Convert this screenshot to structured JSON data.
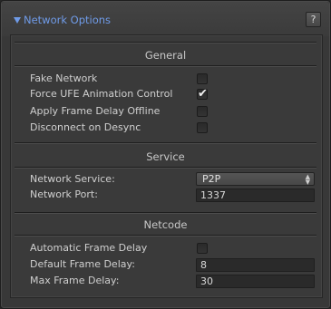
{
  "panel": {
    "title": "Network Options",
    "help_label": "?"
  },
  "sections": {
    "general": {
      "title": "General",
      "fake_network": {
        "label": "Fake Network",
        "checked": false
      },
      "force_ufe_animation_control": {
        "label": "Force UFE Animation Control",
        "checked": true,
        "mark": "✔"
      },
      "apply_frame_delay_offline": {
        "label": "Apply Frame Delay Offline",
        "checked": false
      },
      "disconnect_on_desync": {
        "label": "Disconnect on Desync",
        "checked": false
      }
    },
    "service": {
      "title": "Service",
      "network_service": {
        "label": "Network Service:",
        "value": "P2P"
      },
      "network_port": {
        "label": "Network Port:",
        "value": "1337"
      }
    },
    "netcode": {
      "title": "Netcode",
      "automatic_frame_delay": {
        "label": "Automatic Frame Delay",
        "checked": false
      },
      "default_frame_delay": {
        "label": "Default Frame Delay:",
        "value": "8"
      },
      "max_frame_delay": {
        "label": "Max Frame Delay:",
        "value": "30"
      }
    }
  },
  "icons": {
    "foldout": "foldout-expanded-icon",
    "dropdown": "dropdown-arrows-icon",
    "check": "checkmark-icon"
  },
  "colors": {
    "accent": "#6f9be8",
    "panel_bg": "#383838",
    "field_bg": "#2a2a2a"
  }
}
